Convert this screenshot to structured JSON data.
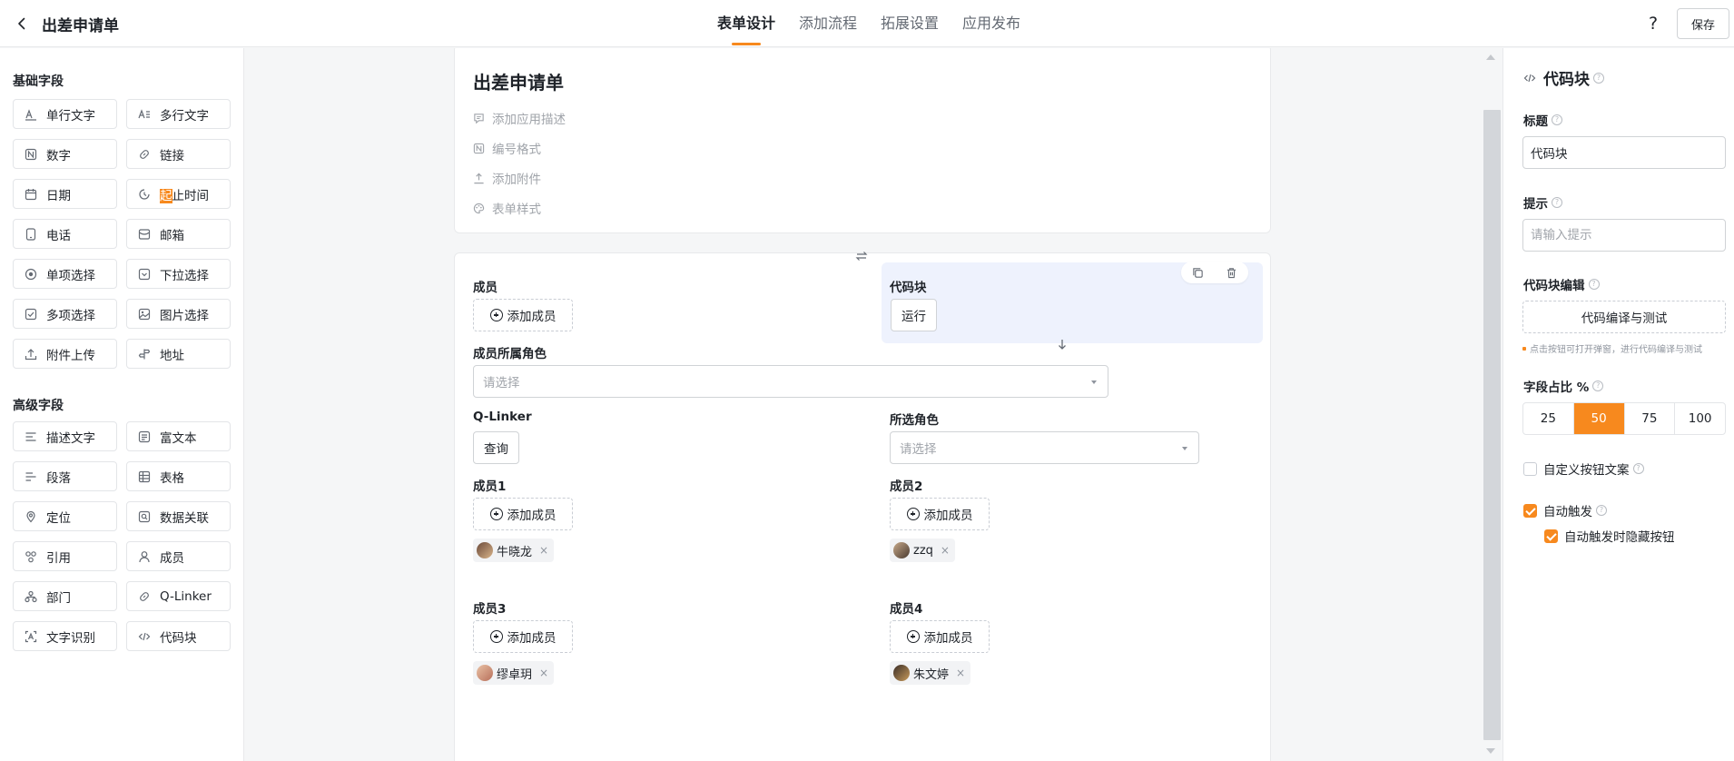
{
  "header": {
    "app_title": "出差申请单",
    "tabs": [
      {
        "label": "表单设计",
        "active": true
      },
      {
        "label": "添加流程",
        "active": false
      },
      {
        "label": "拓展设置",
        "active": false
      },
      {
        "label": "应用发布",
        "active": false
      }
    ],
    "help": "?",
    "save_label": "保存"
  },
  "left_panel": {
    "basic_title": "基础字段",
    "basic_fields": [
      {
        "label": "单行文字",
        "icon": "text-line-icon"
      },
      {
        "label": "多行文字",
        "icon": "text-multiline-icon"
      },
      {
        "label": "数字",
        "icon": "number-icon"
      },
      {
        "label": "链接",
        "icon": "link-icon"
      },
      {
        "label": "日期",
        "icon": "calendar-icon"
      },
      {
        "label_hl": "起",
        "label_rest": "止时间",
        "icon": "time-range-icon"
      },
      {
        "label": "电话",
        "icon": "phone-icon"
      },
      {
        "label": "邮箱",
        "icon": "mail-icon"
      },
      {
        "label": "单项选择",
        "icon": "radio-icon"
      },
      {
        "label": "下拉选择",
        "icon": "dropdown-icon"
      },
      {
        "label": "多项选择",
        "icon": "checkbox-icon"
      },
      {
        "label": "图片选择",
        "icon": "image-icon"
      },
      {
        "label": "附件上传",
        "icon": "upload-icon"
      },
      {
        "label": "地址",
        "icon": "address-icon"
      }
    ],
    "advanced_title": "高级字段",
    "advanced_fields": [
      {
        "label": "描述文字",
        "icon": "description-icon"
      },
      {
        "label": "富文本",
        "icon": "rich-text-icon"
      },
      {
        "label": "段落",
        "icon": "paragraph-icon"
      },
      {
        "label": "表格",
        "icon": "table-icon"
      },
      {
        "label": "定位",
        "icon": "location-icon"
      },
      {
        "label": "数据关联",
        "icon": "data-link-icon"
      },
      {
        "label": "引用",
        "icon": "reference-icon"
      },
      {
        "label": "成员",
        "icon": "member-icon"
      },
      {
        "label": "部门",
        "icon": "department-icon"
      },
      {
        "label": "Q-Linker",
        "icon": "qlinker-icon"
      },
      {
        "label": "文字识别",
        "icon": "ocr-icon"
      },
      {
        "label": "代码块",
        "icon": "code-icon"
      }
    ]
  },
  "form": {
    "title": "出差申请单",
    "meta": [
      {
        "label": "添加应用描述",
        "icon": "comment-icon"
      },
      {
        "label": "编号格式",
        "icon": "number-format-icon"
      },
      {
        "label": "添加附件",
        "icon": "attachment-icon"
      },
      {
        "label": "表单样式",
        "icon": "palette-icon"
      }
    ],
    "member_label": "成员",
    "add_member": "添加成员",
    "code_block_label": "代码块",
    "run_label": "运行",
    "role_label": "成员所属角色",
    "select_placeholder": "请选择",
    "qlinker_label": "Q-Linker",
    "query_label": "查询",
    "selected_role_label": "所选角色",
    "member1_label": "成员1",
    "member2_label": "成员2",
    "member3_label": "成员3",
    "member4_label": "成员4",
    "member1_tag": "牛晓龙",
    "member2_tag": "zzq",
    "member3_tag": "缪卓玥",
    "member4_tag": "朱文婷",
    "remove": "×"
  },
  "right_panel": {
    "title": "代码块",
    "title_label": "标题",
    "title_value": "代码块",
    "hint_label": "提示",
    "hint_placeholder": "请输入提示",
    "code_edit_label": "代码块编辑",
    "code_edit_button": "代码编译与测试",
    "code_edit_note": "点击按钮可打开弹窗，进行代码编译与测试",
    "ratio_label": "字段占比 %",
    "ratio_options": [
      "25",
      "50",
      "75",
      "100"
    ],
    "ratio_selected": "50",
    "custom_btn_text": "自定义按钮文案",
    "auto_trigger": "自动触发",
    "auto_hide": "自动触发时隐藏按钮",
    "custom_btn_checked": false,
    "auto_trigger_checked": true,
    "auto_hide_checked": true
  },
  "colors": {
    "accent": "#f7891e",
    "selected_bg": "#eef2fd"
  }
}
